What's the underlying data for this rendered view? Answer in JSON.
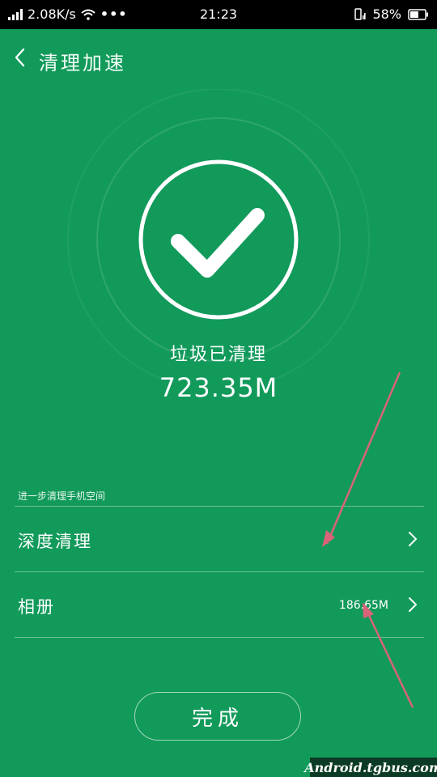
{
  "status_bar": {
    "speed": "2.08K/s",
    "dots": "•••",
    "time": "21:23",
    "battery_percent": "58%",
    "battery_level": 58
  },
  "header": {
    "title": "清理加速"
  },
  "result": {
    "label": "垃圾已清理",
    "size": "723.35M"
  },
  "section": {
    "title": "进一步清理手机空间",
    "items": [
      {
        "label": "深度清理",
        "value": ""
      },
      {
        "label": "相册",
        "value": "186.65M"
      }
    ]
  },
  "done_label": "完成",
  "watermark": "Android.tgbus.com",
  "colors": {
    "background": "#129a5b",
    "status_bar": "#000000",
    "arrow": "#d9637a"
  },
  "icons": [
    "signal-icon",
    "wifi-icon",
    "phone-signal-icon",
    "battery-icon",
    "back-icon",
    "check-icon",
    "chevron-right-icon"
  ]
}
